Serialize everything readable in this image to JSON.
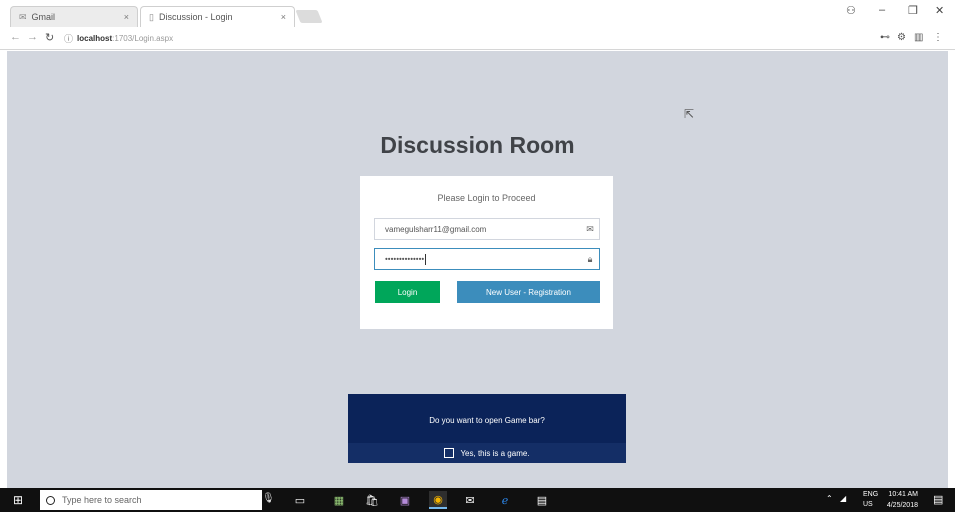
{
  "browser": {
    "tabs": [
      {
        "label": "Gmail",
        "icon": "email-icon"
      },
      {
        "label": "Discussion - Login",
        "icon": "page-icon"
      }
    ],
    "tab_close": "×",
    "address": {
      "host": "localhost",
      "path": ":1703/Login.aspx"
    }
  },
  "page": {
    "brand": "Discussion Room",
    "login": {
      "message": "Please Login to Proceed",
      "email_value": "vamegulsharr11@gmail.com",
      "password_value": "••••••••••••••",
      "login_button": "Login",
      "register_button": "New User - Registration"
    },
    "game_bar": {
      "question": "Do you want to open Game bar?",
      "checkbox_label": "Yes, this is a game."
    }
  },
  "taskbar": {
    "search_placeholder": "Type here to search",
    "tray_lang": "ENG",
    "tray_region": "US",
    "time": "10:41 AM",
    "date": "4/25/2018"
  },
  "colors": {
    "page_bg": "#d2d6de",
    "login_green": "#00a65a",
    "register_blue": "#3c8dbc",
    "game_bar_navy": "#0b2359"
  }
}
